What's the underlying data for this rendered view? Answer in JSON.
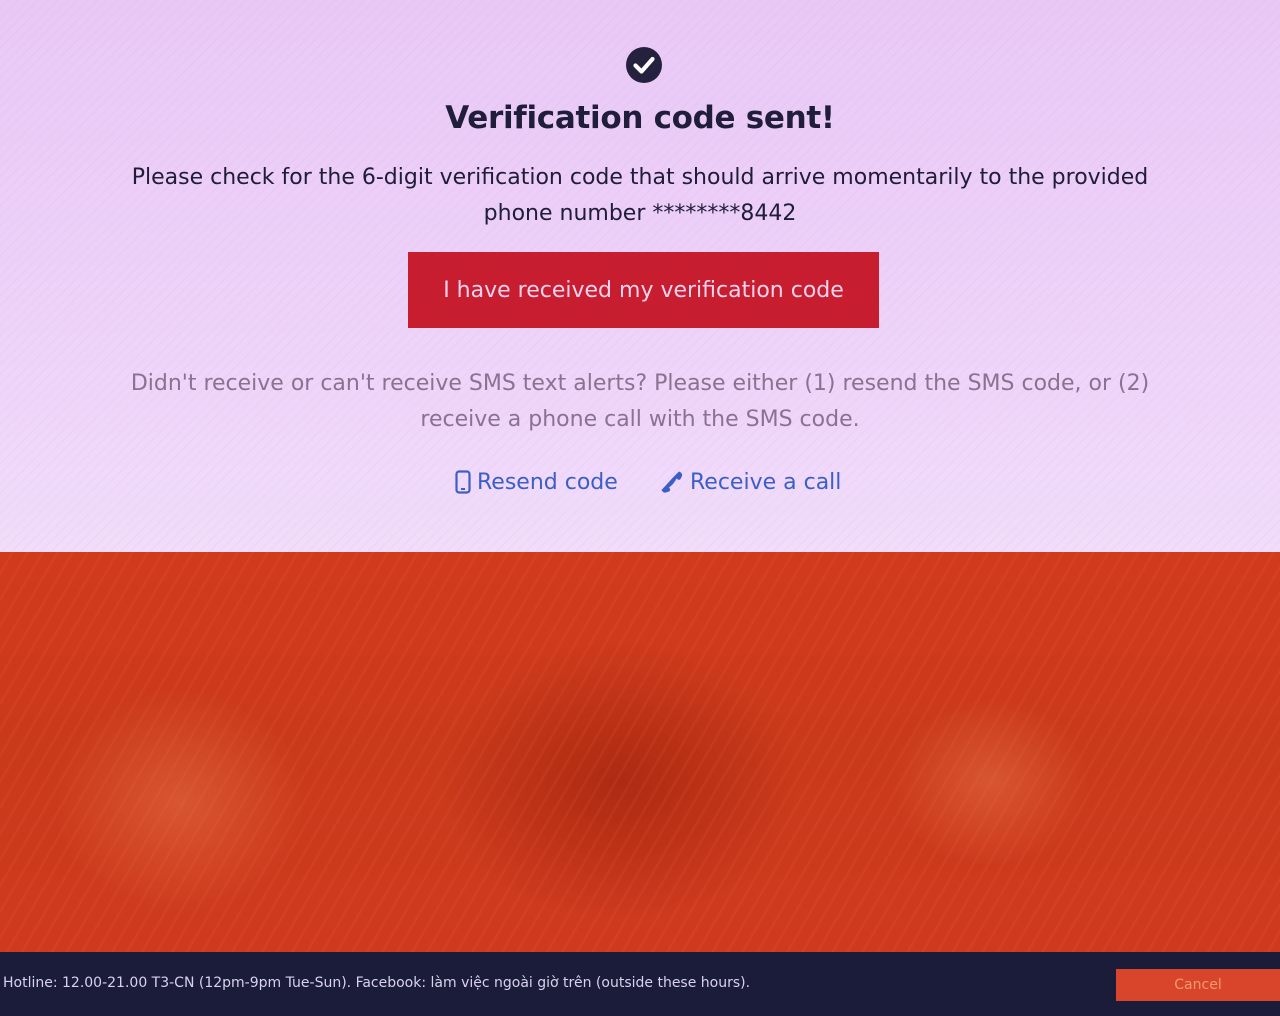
{
  "verification": {
    "status_icon": "check-circle-icon",
    "title": "Verification code sent!",
    "message": "Please check for the 6-digit verification code that should arrive momentarily to the provided phone number ********8442",
    "confirm_button_label": "I have received my verification code",
    "help_text": "Didn't receive or can't receive SMS text alerts? Please either (1) resend the SMS code, or (2) receive a phone call with the SMS code.",
    "resend_link": {
      "icon": "mobile-phone-icon",
      "label": "Resend code"
    },
    "call_link": {
      "icon": "phone-handset-icon",
      "label": "Receive a call"
    }
  },
  "footer": {
    "text": "Hotline: 12.00-21.00 T3-CN (12pm-9pm Tue-Sun). Facebook: làm việc ngoài giờ trên (outside these hours).",
    "cancel_label": "Cancel"
  },
  "colors": {
    "primary_button": "#c81d2e",
    "link": "#3b5fc6",
    "title_text": "#1f1d3a",
    "footer_bg": "#1b1b3a",
    "cancel_button": "#d9452a"
  }
}
